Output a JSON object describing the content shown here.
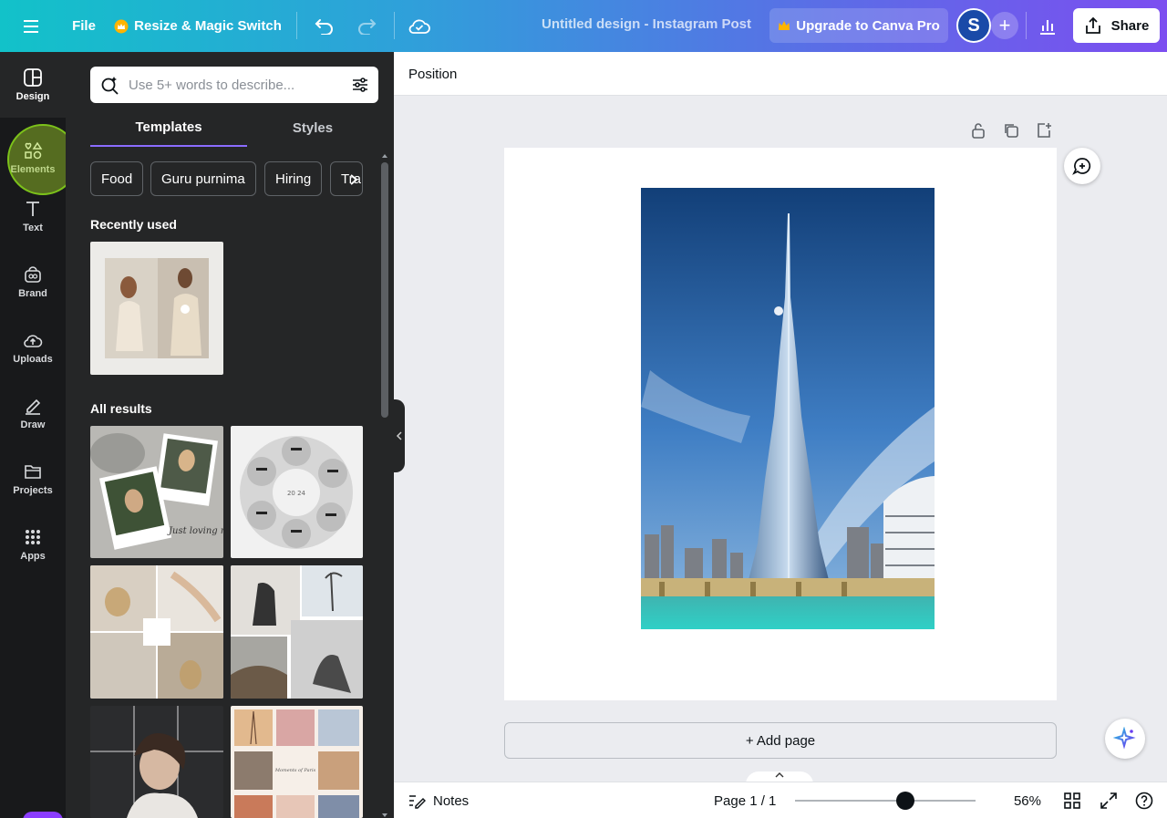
{
  "topbar": {
    "file_label": "File",
    "resize_label": "Resize & Magic Switch",
    "doc_title": "Untitled design - Instagram Post",
    "upgrade_label": "Upgrade to Canva Pro",
    "avatar_initial": "S",
    "share_label": "Share"
  },
  "rail": {
    "items": [
      {
        "label": "Design"
      },
      {
        "label": "Elements"
      },
      {
        "label": "Text"
      },
      {
        "label": "Brand"
      },
      {
        "label": "Uploads"
      },
      {
        "label": "Draw"
      },
      {
        "label": "Projects"
      },
      {
        "label": "Apps"
      }
    ]
  },
  "panel": {
    "search_placeholder": "Use 5+ words to describe...",
    "tabs": [
      {
        "label": "Templates"
      },
      {
        "label": "Styles"
      }
    ],
    "chips": [
      {
        "label": "Food"
      },
      {
        "label": "Guru purnima"
      },
      {
        "label": "Hiring"
      },
      {
        "label": "Tra"
      }
    ],
    "recently_used_title": "Recently used",
    "all_results_title": "All results",
    "template_texts": {
      "polaroid_caption": "Just loving my boho life",
      "circle_year": "20 24",
      "memories": "Moments of Paris"
    }
  },
  "editor": {
    "position_label": "Position",
    "add_page_label": "+ Add page"
  },
  "bottombar": {
    "notes_label": "Notes",
    "page_label": "Page 1 / 1",
    "zoom_label": "56%",
    "zoom_value": 56
  },
  "colors": {
    "accent_purple": "#8b3dff",
    "topbar_start": "#12c2c9",
    "topbar_end": "#7c4ef0",
    "panel_bg": "#252627",
    "rail_bg": "#18191b"
  }
}
